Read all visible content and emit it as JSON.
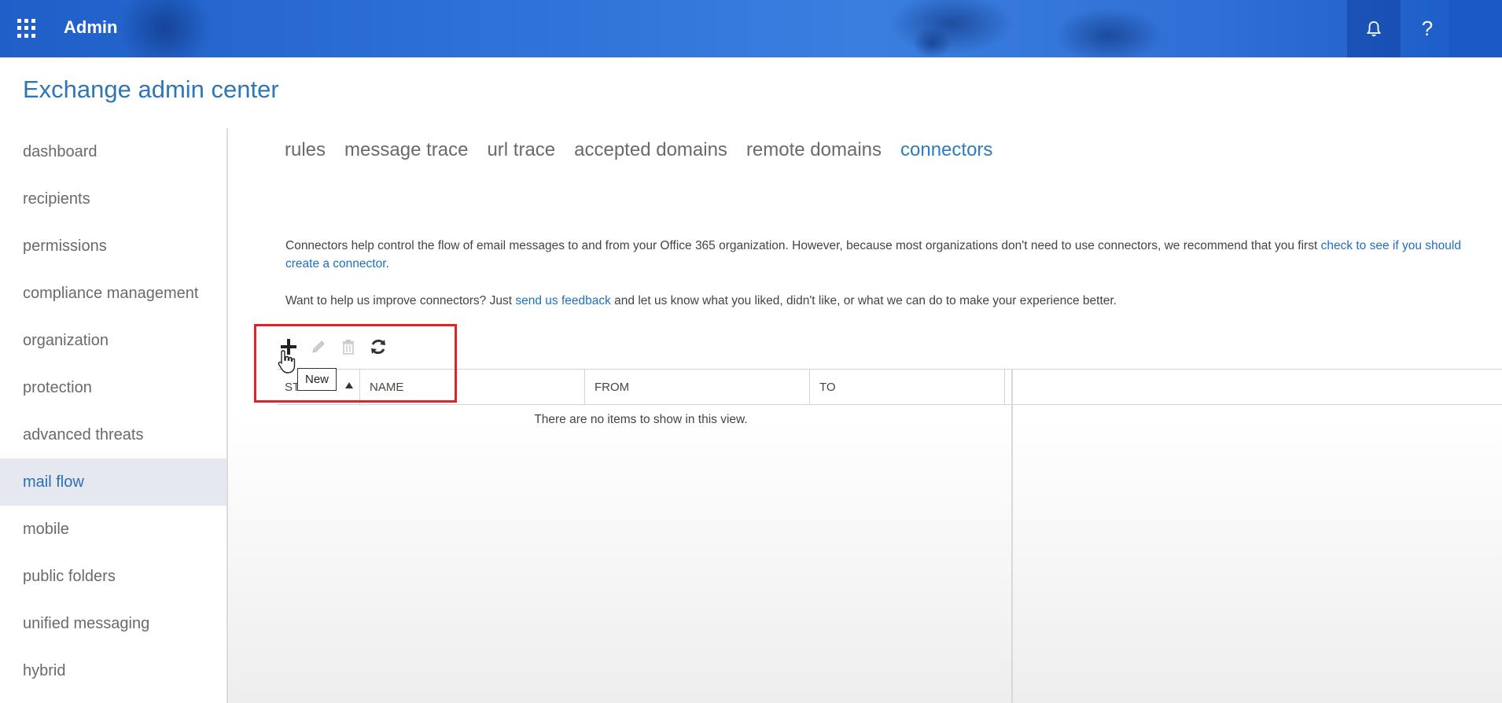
{
  "header": {
    "app_name": "Admin",
    "bell_glyph": "🔔",
    "help_glyph": "?"
  },
  "page": {
    "title": "Exchange admin center"
  },
  "sidebar": {
    "items": [
      {
        "label": "dashboard"
      },
      {
        "label": "recipients"
      },
      {
        "label": "permissions"
      },
      {
        "label": "compliance management"
      },
      {
        "label": "organization"
      },
      {
        "label": "protection"
      },
      {
        "label": "advanced threats"
      },
      {
        "label": "mail flow",
        "active": true
      },
      {
        "label": "mobile"
      },
      {
        "label": "public folders"
      },
      {
        "label": "unified messaging"
      },
      {
        "label": "hybrid"
      }
    ]
  },
  "tabs": {
    "items": [
      {
        "label": "rules"
      },
      {
        "label": "message trace"
      },
      {
        "label": "url trace"
      },
      {
        "label": "accepted domains"
      },
      {
        "label": "remote domains"
      },
      {
        "label": "connectors",
        "active": true
      }
    ]
  },
  "description": {
    "p1_text": "Connectors help control the flow of email messages to and from your Office 365 organization. However, because most organizations don't need to use connectors, we recommend that you first ",
    "p1_link": "check to see if you should create a connector",
    "p1_end": ".",
    "p2_text": "Want to help us improve connectors? Just ",
    "p2_link": "send us feedback",
    "p2_end": " and let us know what you liked, didn't like, or what we can do to make your experience better."
  },
  "toolbar": {
    "new_tooltip": "New"
  },
  "grid": {
    "columns": {
      "status": "ST",
      "name": "NAME",
      "from": "FROM",
      "to": "TO"
    },
    "empty_message": "There are no items to show in this view."
  },
  "colors": {
    "accent": "#2e76b6",
    "highlight": "#e0202a",
    "topbar": "#2c6fd6"
  }
}
